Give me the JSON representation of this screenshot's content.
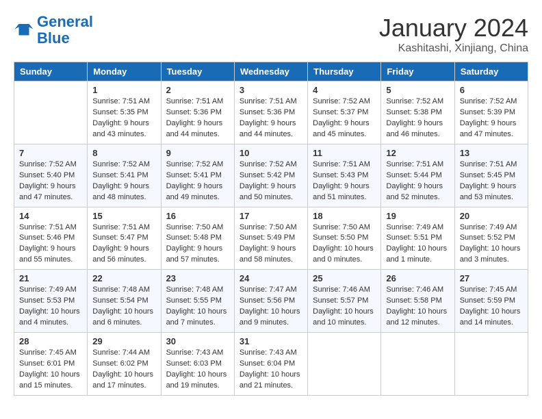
{
  "header": {
    "logo_line1": "General",
    "logo_line2": "Blue",
    "month": "January 2024",
    "location": "Kashitashi, Xinjiang, China"
  },
  "weekdays": [
    "Sunday",
    "Monday",
    "Tuesday",
    "Wednesday",
    "Thursday",
    "Friday",
    "Saturday"
  ],
  "weeks": [
    [
      null,
      {
        "day": 1,
        "sunrise": "7:51 AM",
        "sunset": "5:35 PM",
        "daylight": "9 hours and 43 minutes."
      },
      {
        "day": 2,
        "sunrise": "7:51 AM",
        "sunset": "5:36 PM",
        "daylight": "9 hours and 44 minutes."
      },
      {
        "day": 3,
        "sunrise": "7:51 AM",
        "sunset": "5:36 PM",
        "daylight": "9 hours and 44 minutes."
      },
      {
        "day": 4,
        "sunrise": "7:52 AM",
        "sunset": "5:37 PM",
        "daylight": "9 hours and 45 minutes."
      },
      {
        "day": 5,
        "sunrise": "7:52 AM",
        "sunset": "5:38 PM",
        "daylight": "9 hours and 46 minutes."
      },
      {
        "day": 6,
        "sunrise": "7:52 AM",
        "sunset": "5:39 PM",
        "daylight": "9 hours and 47 minutes."
      }
    ],
    [
      {
        "day": 7,
        "sunrise": "7:52 AM",
        "sunset": "5:40 PM",
        "daylight": "9 hours and 47 minutes."
      },
      {
        "day": 8,
        "sunrise": "7:52 AM",
        "sunset": "5:41 PM",
        "daylight": "9 hours and 48 minutes."
      },
      {
        "day": 9,
        "sunrise": "7:52 AM",
        "sunset": "5:41 PM",
        "daylight": "9 hours and 49 minutes."
      },
      {
        "day": 10,
        "sunrise": "7:52 AM",
        "sunset": "5:42 PM",
        "daylight": "9 hours and 50 minutes."
      },
      {
        "day": 11,
        "sunrise": "7:51 AM",
        "sunset": "5:43 PM",
        "daylight": "9 hours and 51 minutes."
      },
      {
        "day": 12,
        "sunrise": "7:51 AM",
        "sunset": "5:44 PM",
        "daylight": "9 hours and 52 minutes."
      },
      {
        "day": 13,
        "sunrise": "7:51 AM",
        "sunset": "5:45 PM",
        "daylight": "9 hours and 53 minutes."
      }
    ],
    [
      {
        "day": 14,
        "sunrise": "7:51 AM",
        "sunset": "5:46 PM",
        "daylight": "9 hours and 55 minutes."
      },
      {
        "day": 15,
        "sunrise": "7:51 AM",
        "sunset": "5:47 PM",
        "daylight": "9 hours and 56 minutes."
      },
      {
        "day": 16,
        "sunrise": "7:50 AM",
        "sunset": "5:48 PM",
        "daylight": "9 hours and 57 minutes."
      },
      {
        "day": 17,
        "sunrise": "7:50 AM",
        "sunset": "5:49 PM",
        "daylight": "9 hours and 58 minutes."
      },
      {
        "day": 18,
        "sunrise": "7:50 AM",
        "sunset": "5:50 PM",
        "daylight": "10 hours and 0 minutes."
      },
      {
        "day": 19,
        "sunrise": "7:49 AM",
        "sunset": "5:51 PM",
        "daylight": "10 hours and 1 minute."
      },
      {
        "day": 20,
        "sunrise": "7:49 AM",
        "sunset": "5:52 PM",
        "daylight": "10 hours and 3 minutes."
      }
    ],
    [
      {
        "day": 21,
        "sunrise": "7:49 AM",
        "sunset": "5:53 PM",
        "daylight": "10 hours and 4 minutes."
      },
      {
        "day": 22,
        "sunrise": "7:48 AM",
        "sunset": "5:54 PM",
        "daylight": "10 hours and 6 minutes."
      },
      {
        "day": 23,
        "sunrise": "7:48 AM",
        "sunset": "5:55 PM",
        "daylight": "10 hours and 7 minutes."
      },
      {
        "day": 24,
        "sunrise": "7:47 AM",
        "sunset": "5:56 PM",
        "daylight": "10 hours and 9 minutes."
      },
      {
        "day": 25,
        "sunrise": "7:46 AM",
        "sunset": "5:57 PM",
        "daylight": "10 hours and 10 minutes."
      },
      {
        "day": 26,
        "sunrise": "7:46 AM",
        "sunset": "5:58 PM",
        "daylight": "10 hours and 12 minutes."
      },
      {
        "day": 27,
        "sunrise": "7:45 AM",
        "sunset": "5:59 PM",
        "daylight": "10 hours and 14 minutes."
      }
    ],
    [
      {
        "day": 28,
        "sunrise": "7:45 AM",
        "sunset": "6:01 PM",
        "daylight": "10 hours and 15 minutes."
      },
      {
        "day": 29,
        "sunrise": "7:44 AM",
        "sunset": "6:02 PM",
        "daylight": "10 hours and 17 minutes."
      },
      {
        "day": 30,
        "sunrise": "7:43 AM",
        "sunset": "6:03 PM",
        "daylight": "10 hours and 19 minutes."
      },
      {
        "day": 31,
        "sunrise": "7:43 AM",
        "sunset": "6:04 PM",
        "daylight": "10 hours and 21 minutes."
      },
      null,
      null,
      null
    ]
  ]
}
